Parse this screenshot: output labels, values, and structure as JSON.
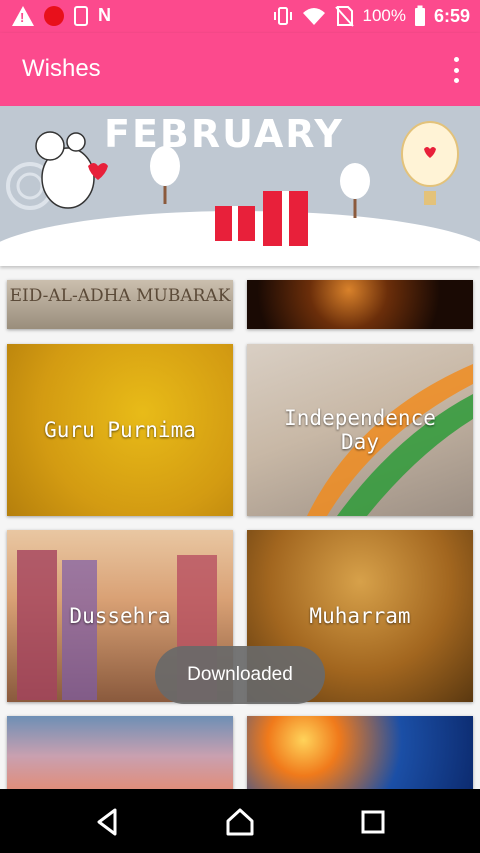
{
  "status_bar": {
    "battery": "100%",
    "time": "6:59",
    "icons": [
      "warning-icon",
      "record-icon",
      "phone-icon",
      "n-icon",
      "vibrate-icon",
      "wifi-icon",
      "no-sim-icon"
    ]
  },
  "app_bar": {
    "title": "Wishes",
    "menu_icon": "more-vert-icon"
  },
  "banner": {
    "title": "FEBRUARY"
  },
  "tiles": [
    {
      "label": "EID-AL-ADHA MUBARAK"
    },
    {
      "label": ""
    },
    {
      "label": "Guru Purnima"
    },
    {
      "label": "Independence Day"
    },
    {
      "label": "Dussehra"
    },
    {
      "label": "Muharram"
    },
    {
      "label": ""
    },
    {
      "label": ""
    }
  ],
  "toast": {
    "text": "Downloaded"
  },
  "nav_bar": {
    "buttons": [
      "back-icon",
      "home-icon",
      "recents-icon"
    ]
  },
  "colors": {
    "primary": "#fc4a8d",
    "toast_bg": "#696969",
    "nav_bg": "#000000"
  }
}
